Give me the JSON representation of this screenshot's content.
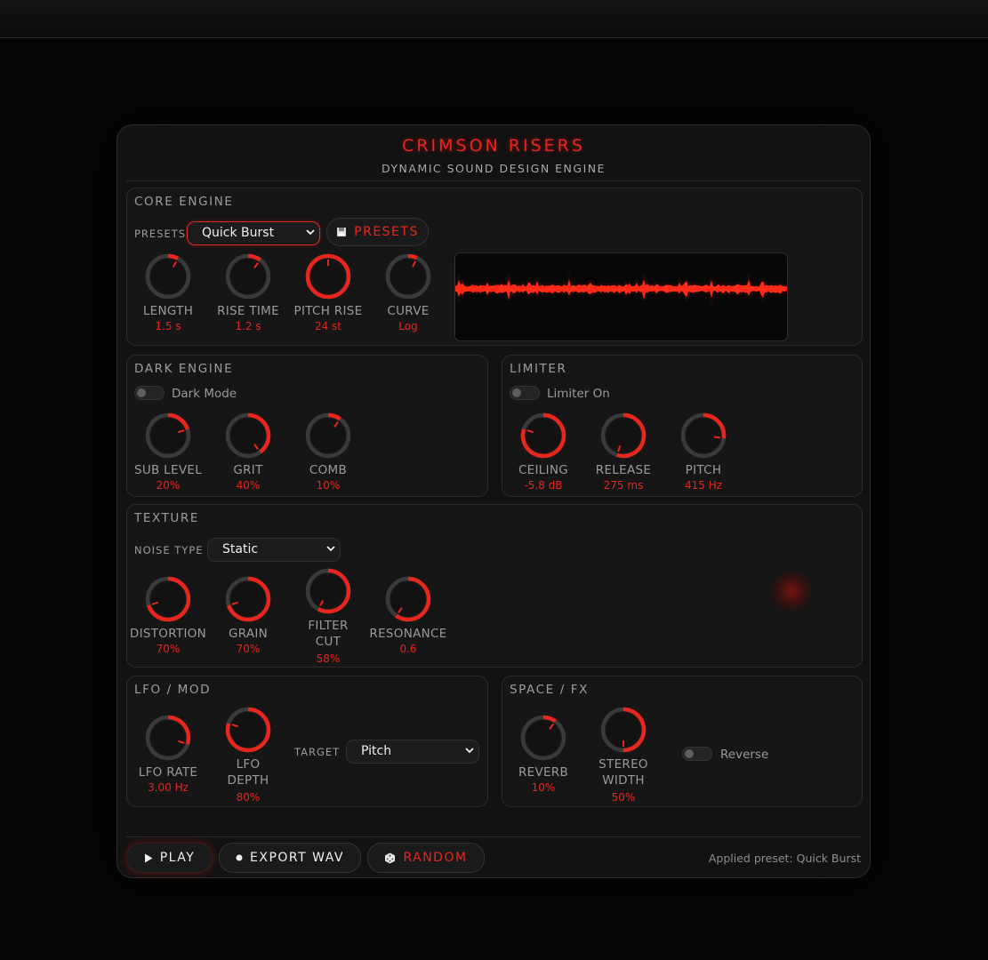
{
  "app": {
    "title": "CRIMSON RISERS",
    "subtitle": "DYNAMIC SOUND DESIGN ENGINE"
  },
  "core": {
    "title": "CORE ENGINE",
    "presets_label": "PRESETS",
    "preset_selected": "Quick Burst",
    "presets_button": "PRESETS",
    "knobs": [
      {
        "label": "LENGTH",
        "value": "1.5 s",
        "level": 0.08
      },
      {
        "label": "RISE TIME",
        "value": "1.2 s",
        "level": 0.1
      },
      {
        "label": "PITCH RISE",
        "value": "24 st",
        "level": 1.0
      },
      {
        "label": "CURVE",
        "value": "Log",
        "level": 0.07
      }
    ]
  },
  "dark": {
    "title": "DARK ENGINE",
    "toggle_label": "Dark Mode",
    "knobs": [
      {
        "label": "SUB LEVEL",
        "value": "20%",
        "level": 0.2
      },
      {
        "label": "GRIT",
        "value": "40%",
        "level": 0.4
      },
      {
        "label": "COMB",
        "value": "10%",
        "level": 0.1
      }
    ]
  },
  "limiter": {
    "title": "LIMITER",
    "toggle_label": "Limiter On",
    "knobs": [
      {
        "label": "CEILING",
        "value": "-5.8 dB",
        "level": 0.8
      },
      {
        "label": "RELEASE",
        "value": "275 ms",
        "level": 0.55
      },
      {
        "label": "PITCH",
        "value": "415 Hz",
        "level": 0.27
      }
    ]
  },
  "texture": {
    "title": "TEXTURE",
    "noise_label": "NOISE TYPE",
    "noise_selected": "Static",
    "knobs": [
      {
        "label": "DISTORTION",
        "value": "70%",
        "level": 0.7
      },
      {
        "label": "GRAIN",
        "value": "70%",
        "level": 0.7
      },
      {
        "label": "FILTER CUT",
        "value": "58%",
        "level": 0.58
      },
      {
        "label": "RESONANCE",
        "value": "0.6",
        "level": 0.6
      }
    ]
  },
  "lfo": {
    "title": "LFO / MOD",
    "target_label": "TARGET",
    "target_selected": "Pitch",
    "knobs": [
      {
        "label": "LFO RATE",
        "value": "3.00 Hz",
        "level": 0.3
      },
      {
        "label": "LFO DEPTH",
        "value": "80%",
        "level": 0.8
      }
    ]
  },
  "space": {
    "title": "SPACE / FX",
    "toggle_label": "Reverse",
    "knobs": [
      {
        "label": "REVERB",
        "value": "10%",
        "level": 0.1
      },
      {
        "label": "STEREO WIDTH",
        "value": "50%",
        "level": 0.5
      }
    ]
  },
  "footer": {
    "play": "PLAY",
    "export": "EXPORT WAV",
    "random": "RANDOM",
    "status": "Applied preset: Quick Burst"
  },
  "colors": {
    "accent": "#e8261e",
    "knob_track": "#3a3a3a",
    "panel": "#161616"
  }
}
